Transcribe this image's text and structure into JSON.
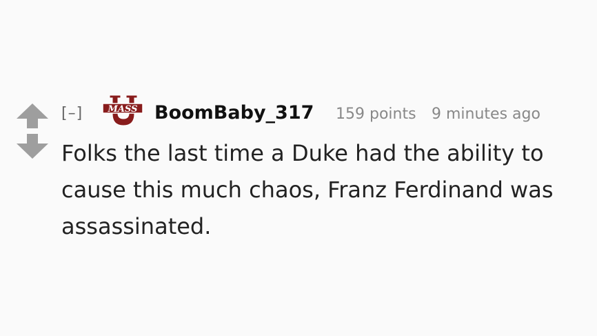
{
  "comment": {
    "collapse_label": "[–]",
    "flair_text": "MASS",
    "flair_letter": "U",
    "author": "BoomBaby_317",
    "score": "159 points",
    "time": "9 minutes ago",
    "body": "Folks the last time a Duke had the ability to cause this much chaos, Franz Ferdinand was assassinated."
  },
  "colors": {
    "arrow": "#9e9e9e",
    "flair_maroon": "#881c1c",
    "author": "#111111",
    "meta": "#888888"
  },
  "icons": {
    "upvote": "upvote-arrow-icon",
    "downvote": "downvote-arrow-icon",
    "flair": "umass-logo-icon"
  }
}
